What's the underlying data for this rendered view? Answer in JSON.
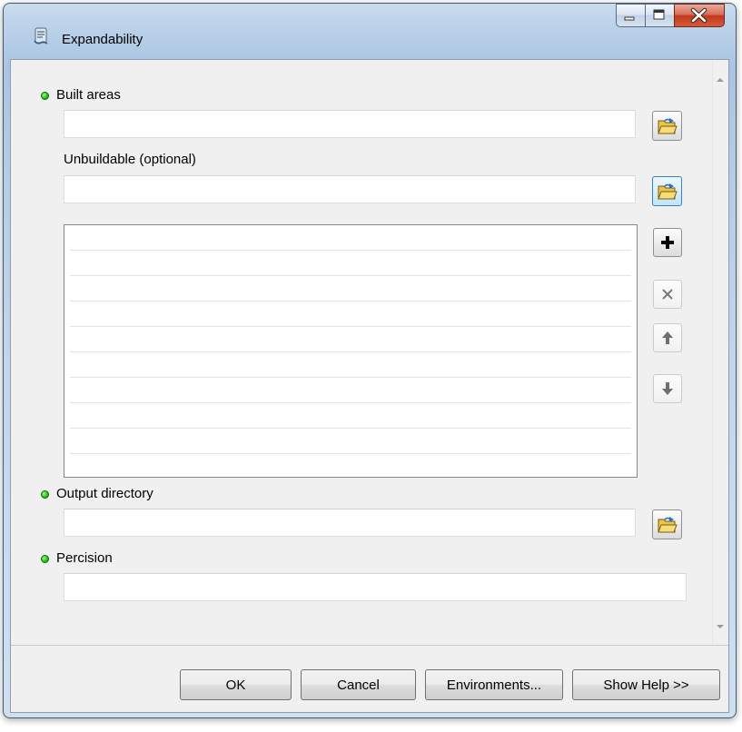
{
  "window": {
    "title": "Expandability",
    "app_icon": "script-tool-icon",
    "caption_buttons": [
      "minimize-icon",
      "maximize-icon",
      "close-icon"
    ]
  },
  "form": {
    "built_areas": {
      "label": "Built areas",
      "value": "",
      "required": true
    },
    "unbuildable": {
      "label": "Unbuildable (optional)",
      "value": "",
      "required": false
    },
    "unbuildable_list": {
      "rows": [
        "",
        "",
        "",
        "",
        "",
        "",
        "",
        "",
        ""
      ]
    },
    "output_directory": {
      "label": "Output directory",
      "value": "",
      "required": true
    },
    "percision": {
      "label": "Percision",
      "value": "",
      "required": true
    }
  },
  "list_tools": [
    "add-icon",
    "remove-icon",
    "move-up-icon",
    "move-down-icon"
  ],
  "buttons": {
    "ok": "OK",
    "cancel": "Cancel",
    "environments": "Environments...",
    "show_help": "Show Help >>"
  },
  "colors": {
    "required_dot": "#1fbf1f",
    "close_button": "#c1391c",
    "frame": "#b9d0e8"
  }
}
